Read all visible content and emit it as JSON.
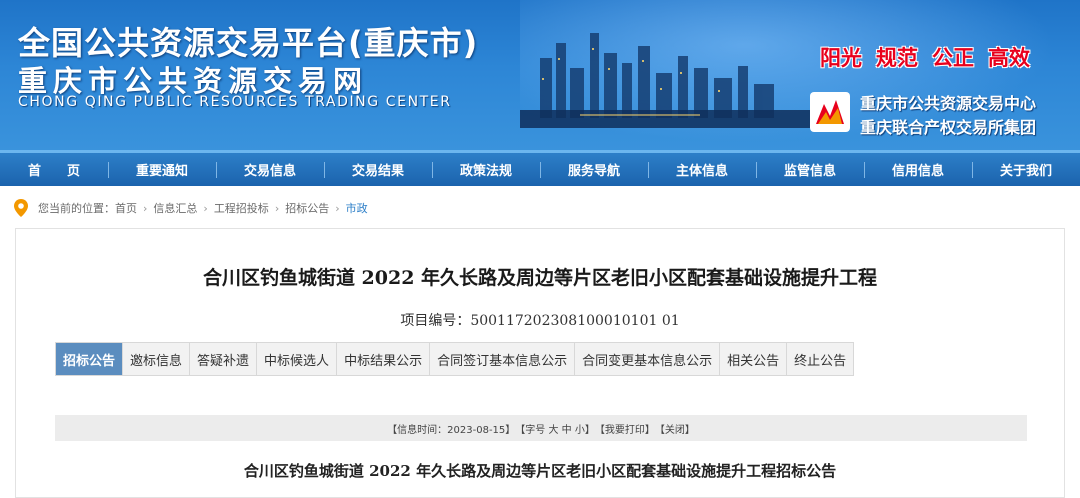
{
  "header": {
    "title_main": "全国公共资源交易平台(重庆市)",
    "title_sub": "重庆市公共资源交易网",
    "title_en": "CHONG QING PUBLIC RESOURCES TRADING CENTER",
    "slogans": [
      "阳光",
      "规范",
      "公正",
      "高效"
    ],
    "org_line1": "重庆市公共资源交易中心",
    "org_line2": "重庆联合产权交易所集团",
    "slogan_color": "#e8001c"
  },
  "nav": {
    "items": [
      "首　　页",
      "重要通知",
      "交易信息",
      "交易结果",
      "政策法规",
      "服务导航",
      "主体信息",
      "监管信息",
      "信用信息",
      "关于我们"
    ]
  },
  "breadcrumb": {
    "prefix": "您当前的位置：",
    "items": [
      "首页",
      "信息汇总",
      "工程招投标",
      "招标公告",
      "市政"
    ],
    "icon": "location-pin-icon"
  },
  "document": {
    "title": "合川区钓鱼城街道 2022 年久长路及周边等片区老旧小区配套基础设施提升工程",
    "project_no_label": "项目编号：",
    "project_no": "500117202308100010101 01",
    "tabs": [
      "招标公告",
      "邀标信息",
      "答疑补遗",
      "中标候选人",
      "中标结果公示",
      "合同签订基本信息公示",
      "合同变更基本信息公示",
      "相关公告",
      "终止公告"
    ],
    "active_tab": 0,
    "info_bar": {
      "time": "【信息时间：2023-08-15】",
      "font_label": "【字号",
      "font_large": "大",
      "font_medium": "中",
      "font_small": "小】",
      "print": "【我要打印】",
      "close": "【关闭】"
    },
    "announcement_title": "合川区钓鱼城街道 2022 年久长路及周边等片区老旧小区配套基础设施提升工程招标公告"
  },
  "colors": {
    "nav_bg": "#1b63ad",
    "active_tab_bg": "#5b8dbf",
    "breadcrumb_active": "#2d7fc8"
  }
}
